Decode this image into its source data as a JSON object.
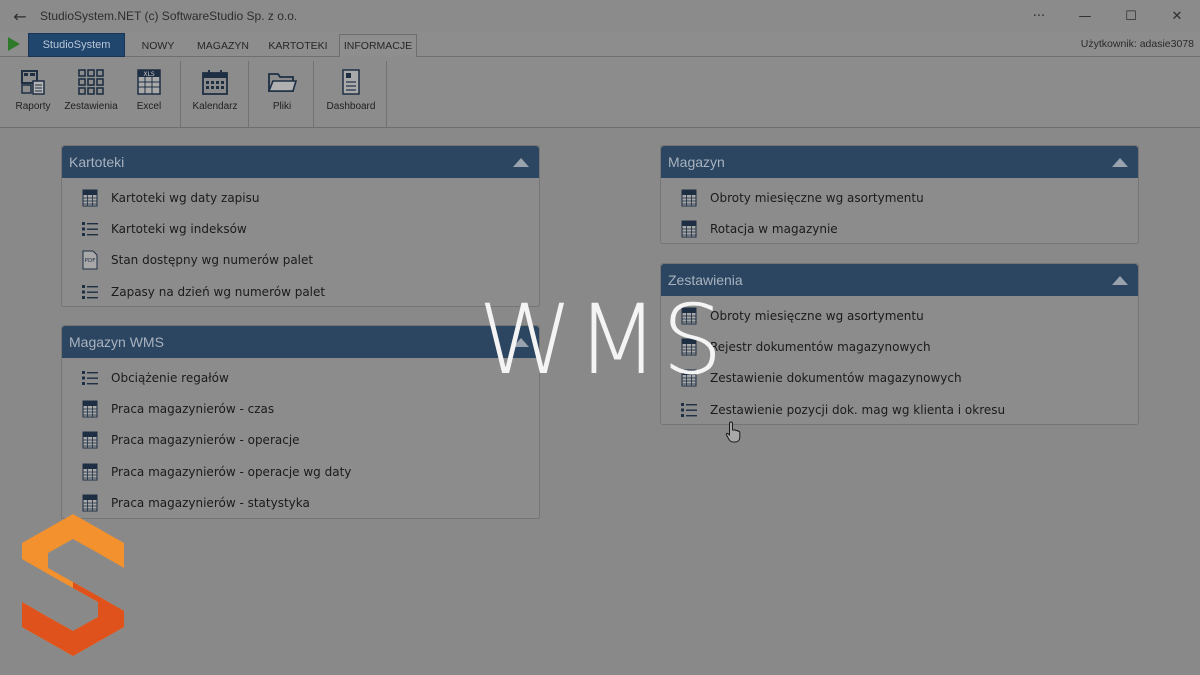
{
  "window": {
    "title": "StudioSystem.NET (c) SoftwareStudio Sp. z o.o.",
    "controls": [
      "more-icon",
      "minimize-icon",
      "maximize-icon",
      "close-icon"
    ]
  },
  "menu": {
    "app_button": "StudioSystem",
    "tabs": [
      {
        "label": "NOWY",
        "active": false
      },
      {
        "label": "MAGAZYN",
        "active": false
      },
      {
        "label": "KARTOTEKI",
        "active": false
      },
      {
        "label": "INFORMACJE",
        "active": true
      }
    ],
    "user": "Użytkownik: adasie3078"
  },
  "ribbon": {
    "buttons": [
      {
        "label": "Raporty",
        "icon": "reports-icon"
      },
      {
        "label": "Zestawienia",
        "icon": "grid-icon"
      },
      {
        "label": "Excel",
        "icon": "xls-icon"
      },
      {
        "label": "Kalendarz",
        "icon": "calendar-icon"
      },
      {
        "label": "Pliki",
        "icon": "folder-icon"
      },
      {
        "label": "Dashboard",
        "icon": "dashboard-icon"
      }
    ]
  },
  "panels": {
    "kartoteki": {
      "title": "Kartoteki",
      "items": [
        {
          "label": "Kartoteki wg daty zapisu",
          "icon": "xls-icon"
        },
        {
          "label": "Kartoteki wg indeksów",
          "icon": "list-icon"
        },
        {
          "label": "Stan dostępny wg numerów palet",
          "icon": "pdf-icon"
        },
        {
          "label": "Zapasy na dzień wg numerów palet",
          "icon": "list-icon"
        }
      ]
    },
    "magazyn_wms": {
      "title": "Magazyn WMS",
      "items": [
        {
          "label": "Obciążenie regałów",
          "icon": "list-icon"
        },
        {
          "label": "Praca magazynierów - czas",
          "icon": "xls-icon"
        },
        {
          "label": "Praca magazynierów - operacje",
          "icon": "xls-icon"
        },
        {
          "label": "Praca magazynierów - operacje wg daty",
          "icon": "xls-icon"
        },
        {
          "label": "Praca magazynierów - statystyka",
          "icon": "xls-icon"
        }
      ]
    },
    "magazyn": {
      "title": "Magazyn",
      "items": [
        {
          "label": "Obroty miesięczne wg asortymentu",
          "icon": "xls-icon"
        },
        {
          "label": "Rotacja w magazynie",
          "icon": "xls-icon"
        }
      ]
    },
    "zestawienia": {
      "title": "Zestawienia",
      "items": [
        {
          "label": "Obroty miesięczne wg asortymentu",
          "icon": "xls-icon"
        },
        {
          "label": "Rejestr dokumentów magazynowych",
          "icon": "xls-icon"
        },
        {
          "label": "Zestawienie dokumentów magazynowych",
          "icon": "xls-icon"
        },
        {
          "label": "Zestawienie pozycji dok. mag wg klienta i okresu",
          "icon": "list-icon"
        }
      ]
    }
  },
  "overlay": {
    "watermark": "WMS",
    "brand_colors": {
      "orange_light": "#f2912e",
      "orange_dark": "#e0521c"
    }
  }
}
